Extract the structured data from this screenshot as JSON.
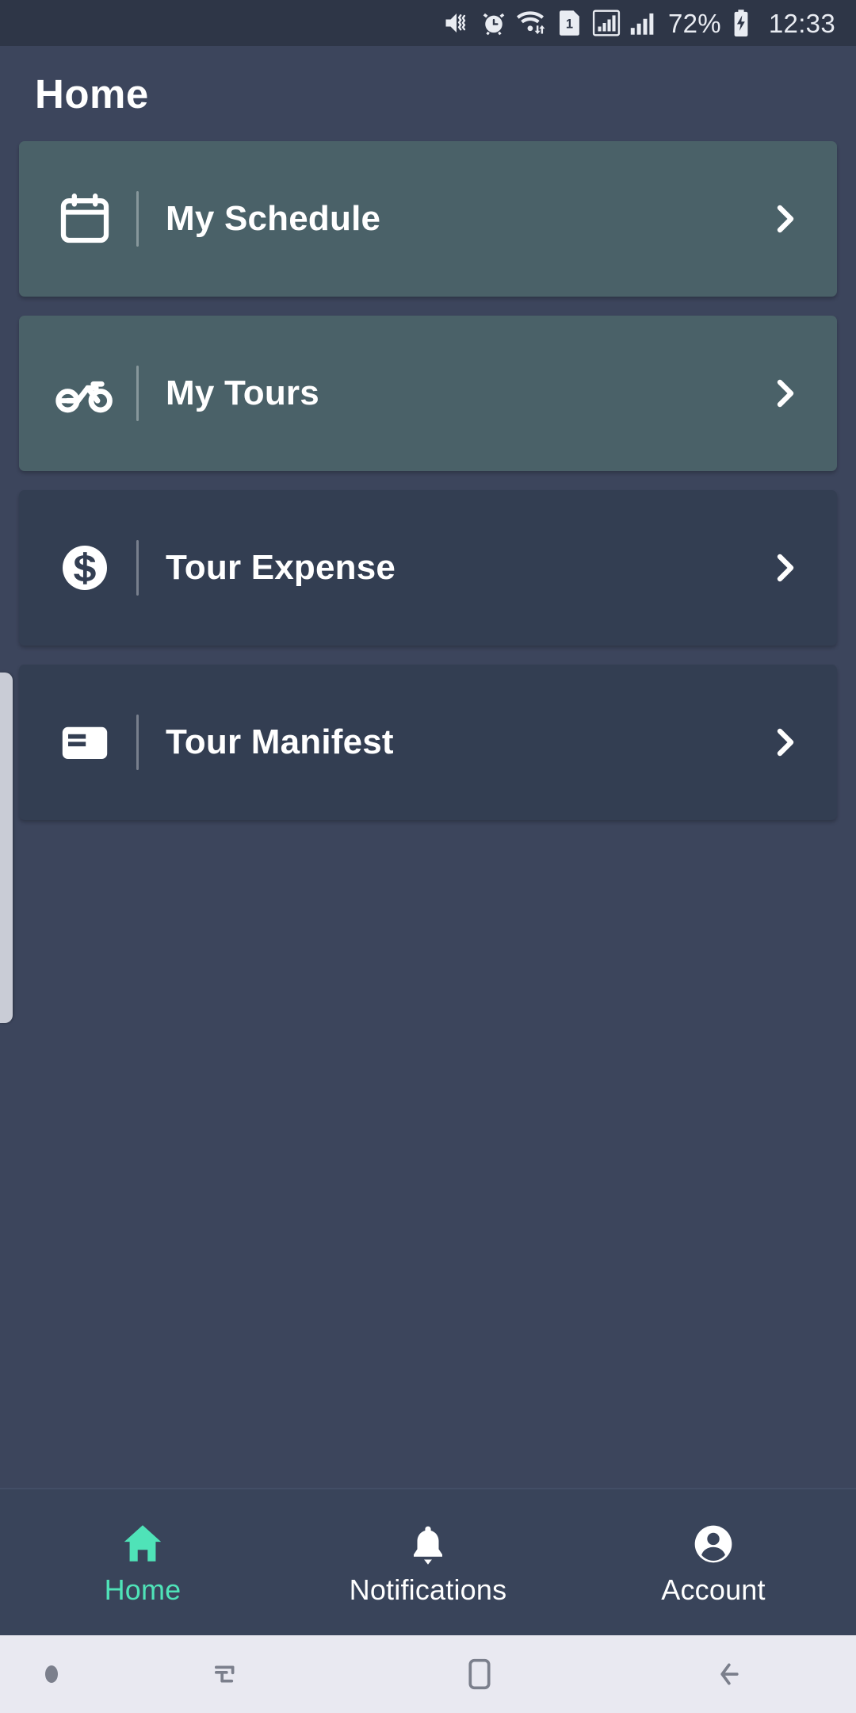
{
  "status_bar": {
    "icons": [
      {
        "name": "mute-vibrate-icon"
      },
      {
        "name": "alarm-clock-icon"
      },
      {
        "name": "wifi-data-transfer-icon"
      },
      {
        "name": "sim-card-1-icon",
        "label": "1"
      },
      {
        "name": "signal-boxed-icon"
      },
      {
        "name": "signal-bars-icon"
      }
    ],
    "battery_percent": "72%",
    "battery_icon": "battery-charging-icon",
    "clock": "12:33"
  },
  "header": {
    "title": "Home"
  },
  "menu": {
    "items": [
      {
        "label": "My Schedule",
        "icon": "calendar-icon",
        "style": "teal",
        "chevron": "chevron-right-icon"
      },
      {
        "label": "My Tours",
        "icon": "motorcycle-icon",
        "style": "teal",
        "chevron": "chevron-right-icon"
      },
      {
        "label": "Tour Expense",
        "icon": "dollar-circle-icon",
        "style": "dark",
        "chevron": "chevron-right-icon"
      },
      {
        "label": "Tour Manifest",
        "icon": "manifest-card-icon",
        "style": "dark",
        "chevron": "chevron-right-icon"
      }
    ]
  },
  "bottom_nav": {
    "items": [
      {
        "label": "Home",
        "icon": "home-icon",
        "active": true
      },
      {
        "label": "Notifications",
        "icon": "bell-icon",
        "active": false
      },
      {
        "label": "Account",
        "icon": "account-user-icon",
        "active": false
      }
    ]
  },
  "system_nav": {
    "buttons": [
      {
        "name": "nav-indicator-dot"
      },
      {
        "name": "recents-icon"
      },
      {
        "name": "home-square-icon"
      },
      {
        "name": "back-arrow-icon"
      }
    ]
  },
  "colors": {
    "page_background": "#3c455c",
    "status_bar_background": "#2e3647",
    "card_teal": "#4a6168",
    "card_dark": "#333e52",
    "accent_active": "#4fe3b8",
    "system_nav_background": "#e9e9f1"
  }
}
